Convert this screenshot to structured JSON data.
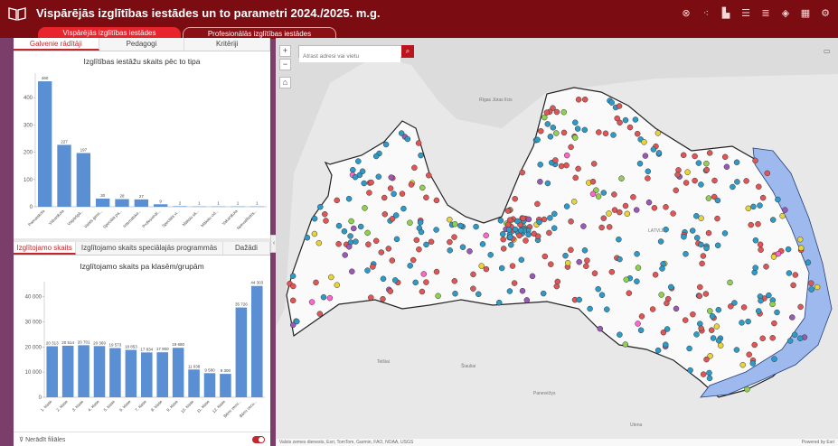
{
  "header": {
    "title": "Vispārējās izglītības iestādes un to parametri 2024./2025. m.g.",
    "tools": [
      "clear-filter-icon",
      "share-icon",
      "chart-icon",
      "list-icon",
      "legend-icon",
      "layers-icon",
      "grid-icon",
      "settings-icon"
    ]
  },
  "subtabs": {
    "active": "Vispārējās izglītības iestādes",
    "inactive": "Profesionālās izglītības iestādes"
  },
  "left": {
    "top_tabs": [
      "Galvenie rādītāji",
      "Pedagogi",
      "Kritēriji"
    ],
    "bottom_tabs": [
      "Izglītojamo skaits",
      "Izglītojamo skaits speciālajās programmās",
      "Dažādi"
    ],
    "filter_label": "Nerādīt filiāles"
  },
  "colors": {
    "bar": "#5b8fd4",
    "accent": "#c0282e",
    "header": "#7a0c12",
    "lake": "#9db9ee"
  },
  "chart_data": [
    {
      "type": "bar",
      "title": "Izglītības iestāžu skaits pēc to tipa",
      "categories": [
        "Pamatskola",
        "Vidusskola",
        "Vispārīgā...",
        "Valsts ģimn...",
        "Speciālā pa...",
        "Internātsko...",
        "Profesionāl...",
        "Speciālā vi...",
        "Mākslu sk...",
        "Mākslu vid...",
        "Vakarskola",
        "Nekvalificēts..."
      ],
      "values": [
        460,
        227,
        197,
        30,
        28,
        27,
        9,
        2,
        1,
        1,
        1,
        1
      ],
      "value_labels": [
        "460",
        "227",
        "197",
        "30",
        "28",
        "27",
        "9",
        "2",
        "1",
        "1",
        "1",
        "1"
      ],
      "yticks": [
        0,
        100,
        200,
        300,
        400
      ],
      "ylim": [
        0,
        490
      ]
    },
    {
      "type": "bar",
      "title": "Izglītojamo skaits pa klasēm/grupām",
      "categories": [
        "1. klase",
        "2. klase",
        "3. klase",
        "4. klase",
        "5. klase",
        "6. klase",
        "7. klase",
        "8. klase",
        "9. klase",
        "10. klase",
        "11. klase",
        "12. klase",
        "Bērni vecu...",
        "Bērni vecu..."
      ],
      "values": [
        20313,
        20514,
        20701,
        20369,
        19573,
        18853,
        17834,
        17900,
        19680,
        11038,
        9580,
        9300,
        35726,
        44303
      ],
      "value_labels": [
        "20 313",
        "20 514",
        "20 701",
        "20 369",
        "19 573",
        "18 853",
        "17 834",
        "17 900",
        "19 680",
        "11 038",
        "9 580",
        "9 300",
        "35 726",
        "44 303"
      ],
      "yticks": [
        0,
        10000,
        20000,
        30000,
        40000
      ],
      "ytick_labels": [
        "0",
        "10 000",
        "20 000",
        "30 000",
        "40 000"
      ],
      "ylim": [
        0,
        46000
      ]
    }
  ],
  "map": {
    "search_placeholder": "Atrast adresi vai vietu",
    "attribution": "Valsts zemes dienests, Esri, TomTom, Garmin, FAO, NOAA, USGS",
    "powered_by": "Powered by Esri",
    "places": [
      "Rīgas Jūras līcis",
      "LATVIJA",
      "Telšiai",
      "Šiauliai",
      "Panevėžys",
      "Utena"
    ],
    "point_colors": [
      "#e05555",
      "#2e9ac8",
      "#e8d43a",
      "#8fd14f",
      "#9a59b5",
      "#ff66cc"
    ]
  }
}
